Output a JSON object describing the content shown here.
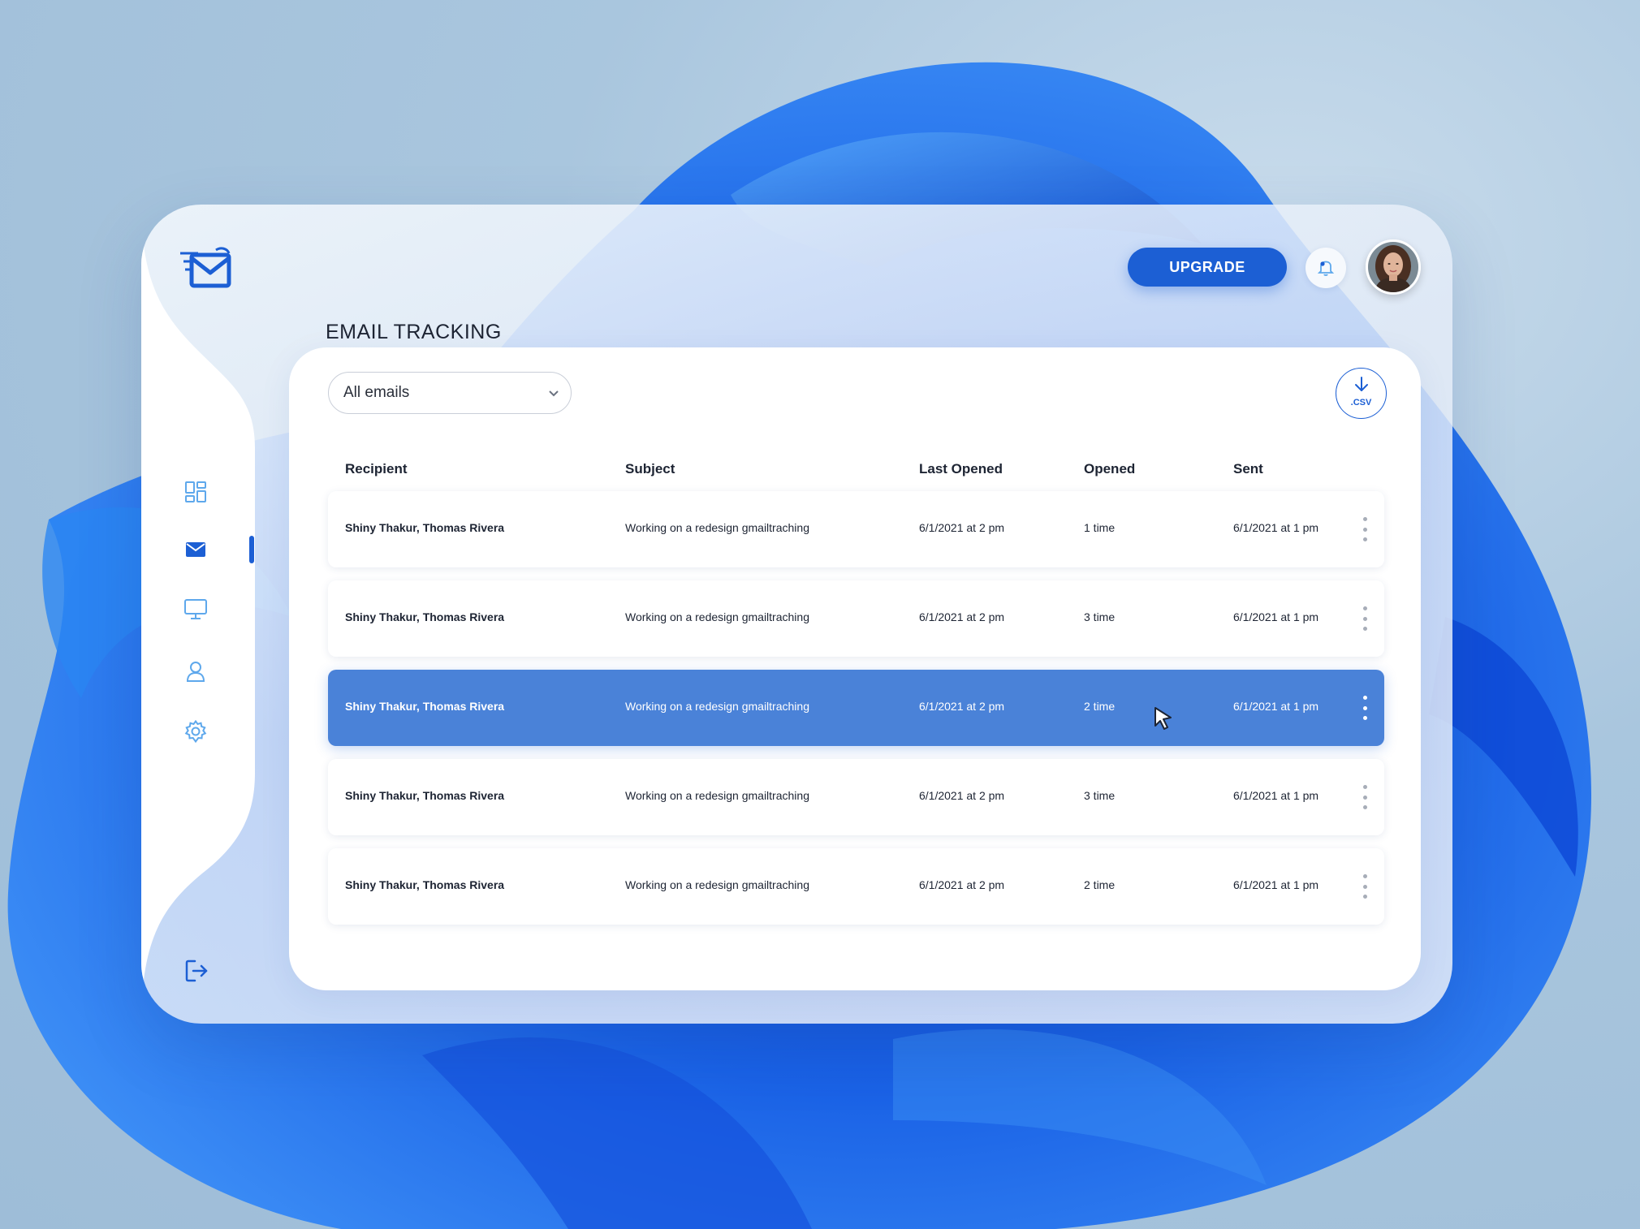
{
  "header": {
    "upgrade_label": "UPGRADE",
    "page_title": "EMAIL TRACKING"
  },
  "sidebar": {
    "items": [
      {
        "name": "dashboard-icon",
        "active": false
      },
      {
        "name": "mail-icon",
        "active": true
      },
      {
        "name": "monitor-icon",
        "active": false
      },
      {
        "name": "user-icon",
        "active": false
      },
      {
        "name": "gear-icon",
        "active": false
      }
    ],
    "footer_icon": "logout-icon"
  },
  "toolbar": {
    "filter_value": "All emails",
    "csv_label": ".CSV"
  },
  "table": {
    "columns": [
      "Recipient",
      "Subject",
      "Last Opened",
      "Opened",
      "Sent"
    ],
    "rows": [
      {
        "recipient": "Shiny Thakur, Thomas Rivera",
        "subject": "Working on a redesign gmailtraching",
        "last_opened": "6/1/2021 at 2 pm",
        "opened": "1 time",
        "sent": "6/1/2021 at 1 pm",
        "selected": false
      },
      {
        "recipient": "Shiny Thakur, Thomas Rivera",
        "subject": "Working on a redesign gmailtraching",
        "last_opened": "6/1/2021 at 2 pm",
        "opened": "3 time",
        "sent": "6/1/2021 at 1 pm",
        "selected": false
      },
      {
        "recipient": "Shiny Thakur, Thomas Rivera",
        "subject": "Working on a redesign gmailtraching",
        "last_opened": "6/1/2021 at 2 pm",
        "opened": "2 time",
        "sent": "6/1/2021 at 1 pm",
        "selected": true
      },
      {
        "recipient": "Shiny Thakur, Thomas Rivera",
        "subject": "Working on a redesign gmailtraching",
        "last_opened": "6/1/2021 at 2 pm",
        "opened": "3 time",
        "sent": "6/1/2021 at 1 pm",
        "selected": false
      },
      {
        "recipient": "Shiny Thakur, Thomas Rivera",
        "subject": "Working on a redesign gmailtraching",
        "last_opened": "6/1/2021 at 2 pm",
        "opened": "2 time",
        "sent": "6/1/2021 at 1 pm",
        "selected": false
      }
    ]
  },
  "colors": {
    "accent": "#1c5fd4",
    "selected_row": "#4a82d8",
    "icon_light": "#5ea8ec"
  }
}
